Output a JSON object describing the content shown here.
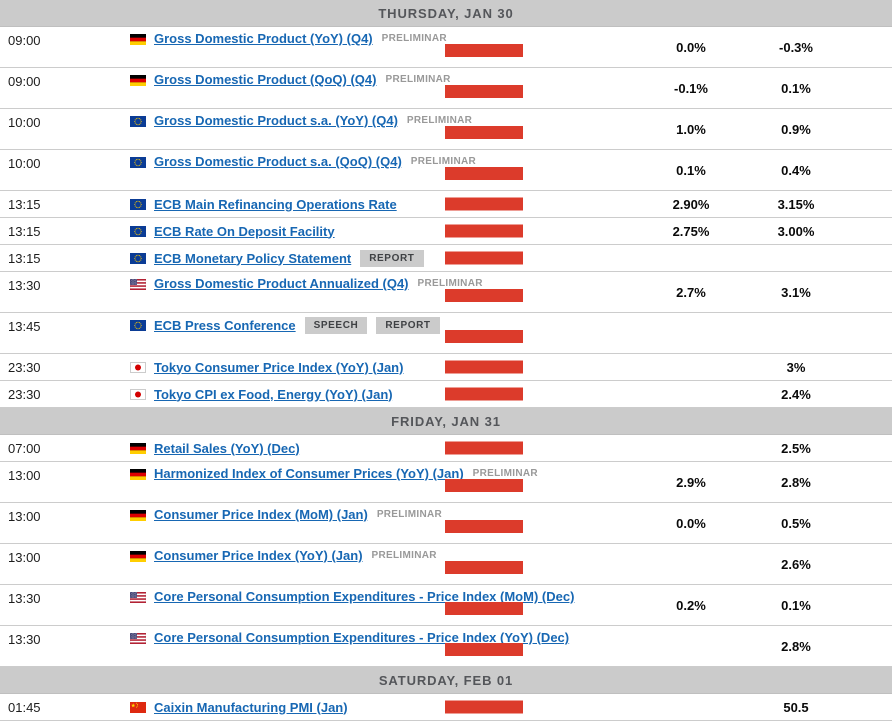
{
  "colors": {
    "bar": "#dc3b2b",
    "link": "#1767b3",
    "header_bg": "#cbcbcb",
    "header_text": "#54565a",
    "badge_bg": "#cbcbcb",
    "badge_text": "#3f4144",
    "tag_text": "#999999",
    "row_border": "#cccccc"
  },
  "countries": {
    "de": "germany",
    "eu": "european-union",
    "us": "united-states",
    "jp": "japan",
    "cn": "china"
  },
  "calendar": {
    "sections": [
      {
        "header": "THURSDAY, JAN 30",
        "events": [
          {
            "time": "09:00",
            "country": "de",
            "title": "Gross Domestic Product (YoY) (Q4)",
            "tag": "PRELIMINAR",
            "badges": [],
            "lines": 2,
            "volatility_bar": true,
            "values": [
              "0.0%",
              "-0.3%"
            ]
          },
          {
            "time": "09:00",
            "country": "de",
            "title": "Gross Domestic Product (QoQ) (Q4)",
            "tag": "PRELIMINAR",
            "badges": [],
            "lines": 2,
            "volatility_bar": true,
            "values": [
              "-0.1%",
              "0.1%"
            ]
          },
          {
            "time": "10:00",
            "country": "eu",
            "title": "Gross Domestic Product s.a. (YoY) (Q4)",
            "tag": "PRELIMINAR",
            "badges": [],
            "lines": 2,
            "volatility_bar": true,
            "values": [
              "1.0%",
              "0.9%"
            ]
          },
          {
            "time": "10:00",
            "country": "eu",
            "title": "Gross Domestic Product s.a. (QoQ) (Q4)",
            "tag": "PRELIMINAR",
            "badges": [],
            "lines": 2,
            "volatility_bar": true,
            "values": [
              "0.1%",
              "0.4%"
            ]
          },
          {
            "time": "13:15",
            "country": "eu",
            "title": "ECB Main Refinancing Operations Rate",
            "tag": "",
            "badges": [],
            "lines": 1,
            "volatility_bar": true,
            "values": [
              "2.90%",
              "3.15%"
            ]
          },
          {
            "time": "13:15",
            "country": "eu",
            "title": "ECB Rate On Deposit Facility",
            "tag": "",
            "badges": [],
            "lines": 1,
            "volatility_bar": true,
            "values": [
              "2.75%",
              "3.00%"
            ]
          },
          {
            "time": "13:15",
            "country": "eu",
            "title": "ECB Monetary Policy Statement",
            "tag": "",
            "badges": [
              "REPORT"
            ],
            "lines": 1,
            "volatility_bar": true,
            "values": [
              "",
              ""
            ]
          },
          {
            "time": "13:30",
            "country": "us",
            "title": "Gross Domestic Product Annualized (Q4)",
            "tag": "PRELIMINAR",
            "badges": [],
            "lines": 2,
            "volatility_bar": true,
            "values": [
              "2.7%",
              "3.1%"
            ]
          },
          {
            "time": "13:45",
            "country": "eu",
            "title": "ECB Press Conference",
            "tag": "",
            "badges": [
              "SPEECH",
              "REPORT"
            ],
            "lines": 2,
            "volatility_bar": true,
            "values": [
              "",
              ""
            ]
          },
          {
            "time": "23:30",
            "country": "jp",
            "title": "Tokyo Consumer Price Index (YoY) (Jan)",
            "tag": "",
            "badges": [],
            "lines": 1,
            "volatility_bar": true,
            "values": [
              "",
              "3%"
            ]
          },
          {
            "time": "23:30",
            "country": "jp",
            "title": "Tokyo CPI ex Food, Energy (YoY) (Jan)",
            "tag": "",
            "badges": [],
            "lines": 1,
            "volatility_bar": true,
            "values": [
              "",
              "2.4%"
            ]
          }
        ]
      },
      {
        "header": "FRIDAY, JAN 31",
        "events": [
          {
            "time": "07:00",
            "country": "de",
            "title": "Retail Sales (YoY) (Dec)",
            "tag": "",
            "badges": [],
            "lines": 1,
            "volatility_bar": true,
            "values": [
              "",
              "2.5%"
            ]
          },
          {
            "time": "13:00",
            "country": "de",
            "title": "Harmonized Index of Consumer Prices (YoY) (Jan)",
            "tag": "PRELIMINAR",
            "badges": [],
            "lines": 2,
            "volatility_bar": true,
            "values": [
              "2.9%",
              "2.8%"
            ]
          },
          {
            "time": "13:00",
            "country": "de",
            "title": "Consumer Price Index (MoM) (Jan)",
            "tag": "PRELIMINAR",
            "badges": [],
            "lines": 2,
            "volatility_bar": true,
            "values": [
              "0.0%",
              "0.5%"
            ]
          },
          {
            "time": "13:00",
            "country": "de",
            "title": "Consumer Price Index (YoY) (Jan)",
            "tag": "PRELIMINAR",
            "badges": [],
            "lines": 2,
            "volatility_bar": true,
            "values": [
              "",
              "2.6%"
            ]
          },
          {
            "time": "13:30",
            "country": "us",
            "title": "Core Personal Consumption Expenditures - Price Index (MoM) (Dec)",
            "tag": "",
            "badges": [],
            "lines": 2,
            "volatility_bar": true,
            "values": [
              "0.2%",
              "0.1%"
            ]
          },
          {
            "time": "13:30",
            "country": "us",
            "title": "Core Personal Consumption Expenditures - Price Index (YoY) (Dec)",
            "tag": "",
            "badges": [],
            "lines": 2,
            "volatility_bar": true,
            "values": [
              "",
              "2.8%"
            ]
          }
        ]
      },
      {
        "header": "SATURDAY, FEB 01",
        "events": [
          {
            "time": "01:45",
            "country": "cn",
            "title": "Caixin Manufacturing PMI (Jan)",
            "tag": "",
            "badges": [],
            "lines": 1,
            "volatility_bar": true,
            "values": [
              "",
              "50.5"
            ]
          }
        ]
      }
    ]
  }
}
